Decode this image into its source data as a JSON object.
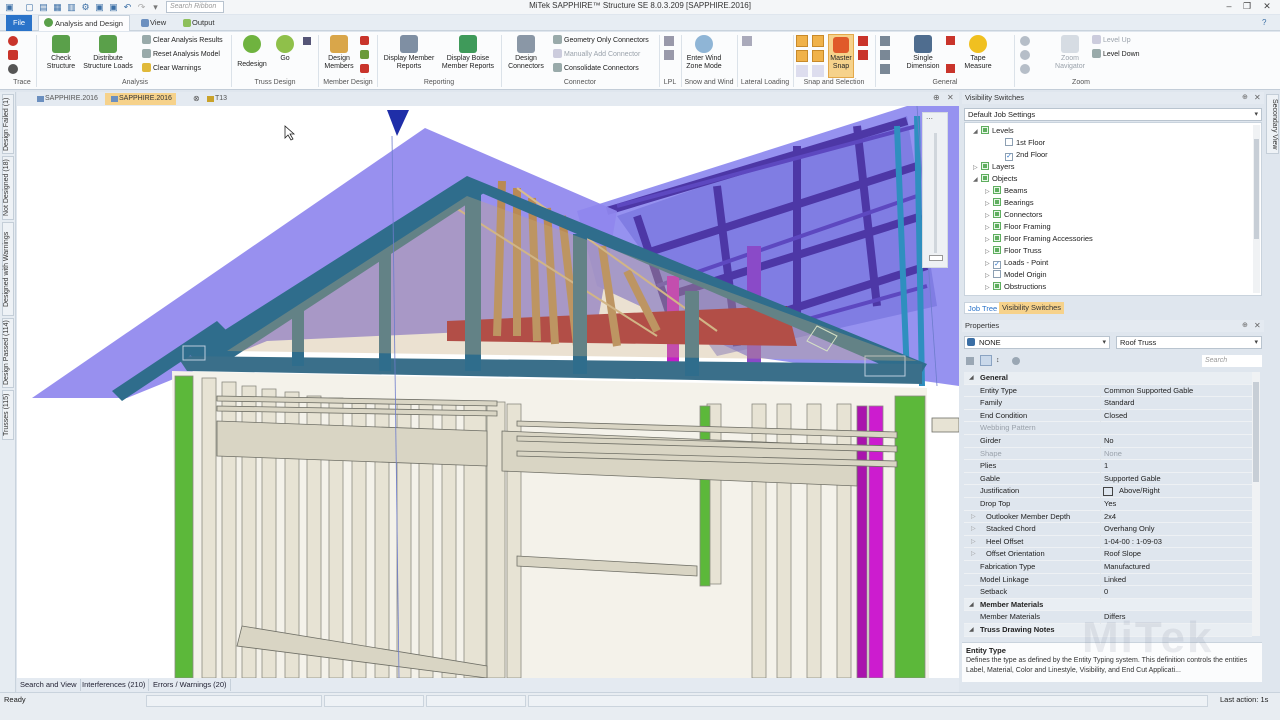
{
  "app": {
    "title": "MiTek SAPPHIRE™ Structure SE 8.0.3.209  [SAPPHIRE.2016]",
    "search_placeholder": "Search Ribbon",
    "watermark": "MiTek"
  },
  "tabs": [
    {
      "label": "File"
    },
    {
      "label": "Analysis and Design"
    },
    {
      "label": "View"
    },
    {
      "label": "Output"
    }
  ],
  "ribbon": {
    "trace": "Trace",
    "check_structure": "Check\nStructure",
    "distribute": "Distribute\nStructure Loads",
    "clear_results": "Clear Analysis Results",
    "reset_model": "Reset Analysis Model",
    "clear_warnings": "Clear Warnings",
    "redesign": "Redesign",
    "go": "Go",
    "design_members": "Design\nMembers",
    "display_member_reports": "Display Member\nReports",
    "display_boise": "Display Boise\nMember Reports",
    "design_connectors": "Design\nConnectors",
    "geometry_only": "Geometry Only Connectors",
    "manually_add": "Manually Add Connector",
    "consolidate": "Consolidate Connectors",
    "enter_wind": "Enter Wind\nZone Mode",
    "master_snap": "Master\nSnap",
    "single_dimension": "Single\nDimension",
    "tape_measure": "Tape\nMeasure",
    "zoom_navigator": "Zoom\nNavigator",
    "level_up": "Level Up",
    "level_down": "Level Down",
    "groups": {
      "analysis": "Analysis",
      "truss_design": "Truss Design",
      "member_design": "Member Design",
      "reporting": "Reporting",
      "connector": "Connector",
      "lpl": "LPL",
      "snow_wind": "Snow and Wind",
      "lateral": "Lateral Loading",
      "snap": "Snap and Selection",
      "general": "General",
      "zoom": "Zoom"
    }
  },
  "left_tabs": [
    "Design Failed (1)",
    "Not Designed (18)",
    "Designed with Warnings",
    "Design Passed (114)",
    "Trusses (115)"
  ],
  "doc_tabs": [
    {
      "label": "SAPPHIRE.2016",
      "active": false
    },
    {
      "label": "SAPPHIRE.2016",
      "active": true
    },
    {
      "label": "T13",
      "active": false
    }
  ],
  "visibility": {
    "header": "Visibility Switches",
    "job": "Default Job Settings",
    "items": [
      {
        "label": "Levels",
        "indent": 0,
        "expanded": true,
        "checked": "green"
      },
      {
        "label": "1st Floor",
        "indent": 2,
        "checked": "none"
      },
      {
        "label": "2nd Floor",
        "indent": 2,
        "checked": "check"
      },
      {
        "label": "Layers",
        "indent": 0,
        "expanded": false,
        "checked": "green"
      },
      {
        "label": "Objects",
        "indent": 0,
        "expanded": true,
        "checked": "green"
      },
      {
        "label": "Beams",
        "indent": 1,
        "checked": "green"
      },
      {
        "label": "Bearings",
        "indent": 1,
        "checked": "green"
      },
      {
        "label": "Connectors",
        "indent": 1,
        "checked": "green"
      },
      {
        "label": "Floor Framing",
        "indent": 1,
        "checked": "green"
      },
      {
        "label": "Floor Framing Accessories",
        "indent": 1,
        "checked": "green"
      },
      {
        "label": "Floor Truss",
        "indent": 1,
        "checked": "green"
      },
      {
        "label": "Loads - Point",
        "indent": 1,
        "checked": "check"
      },
      {
        "label": "Model Origin",
        "indent": 1,
        "checked": "none"
      },
      {
        "label": "Obstructions",
        "indent": 1,
        "checked": "green"
      }
    ],
    "tab_job_tree": "Job Tree",
    "tab_visibility": "Visibility Switches"
  },
  "properties": {
    "header": "Properties",
    "selector": "NONE",
    "type": "Roof Truss",
    "search_placeholder": "Search",
    "rows": [
      {
        "name": "General",
        "value": "",
        "kind": "cat"
      },
      {
        "name": "Entity Type",
        "value": "Common Supported Gable",
        "kind": "row"
      },
      {
        "name": "Family",
        "value": "Standard",
        "kind": "row"
      },
      {
        "name": "End Condition",
        "value": "Closed",
        "kind": "row"
      },
      {
        "name": "Webbing Pattern",
        "value": "",
        "kind": "dim"
      },
      {
        "name": "Girder",
        "value": "No",
        "kind": "row"
      },
      {
        "name": "Shape",
        "value": "None",
        "kind": "dim"
      },
      {
        "name": "Plies",
        "value": "1",
        "kind": "row"
      },
      {
        "name": "Gable",
        "value": "Supported Gable",
        "kind": "row"
      },
      {
        "name": "Justification",
        "value": "Above/Right",
        "kind": "row"
      },
      {
        "name": "Drop Top",
        "value": "Yes",
        "kind": "row"
      },
      {
        "name": "Outlooker Member Depth",
        "value": "2x4",
        "kind": "sub"
      },
      {
        "name": "Stacked Chord",
        "value": "Overhang Only",
        "kind": "sub"
      },
      {
        "name": "Heel Offset",
        "value": "1-04-00 : 1-09-03",
        "kind": "sub"
      },
      {
        "name": "Offset Orientation",
        "value": "Roof Slope",
        "kind": "sub"
      },
      {
        "name": "Fabrication Type",
        "value": "Manufactured",
        "kind": "row"
      },
      {
        "name": "Model Linkage",
        "value": "Linked",
        "kind": "row"
      },
      {
        "name": "Setback",
        "value": "0",
        "kind": "row"
      },
      {
        "name": "Member Materials",
        "value": "",
        "kind": "cat"
      },
      {
        "name": "Member Materials",
        "value": "Differs",
        "kind": "row"
      },
      {
        "name": "Truss Drawing Notes",
        "value": "",
        "kind": "cat"
      }
    ],
    "desc_title": "Entity Type",
    "desc_text": "Defines the type as defined by the Entity Typing system. This definition controls the entities Label, Material, Color and Linestyle, Visibility, and End Cut Applicati..."
  },
  "bottom_tabs": [
    "Search and View",
    "Interferences (210)",
    "Errors / Warnings (20)"
  ],
  "status": {
    "left": "Ready",
    "right": "Last action: 1s"
  },
  "right_vtab": "Secondary View",
  "colors": {
    "accent": "#2a73c9",
    "roof": "#8f87ee",
    "truss_chord": "#2f6d8c",
    "wall_stud": "#e7e3d4",
    "green_stud": "#5cb83a",
    "magenta": "#cc1ccf",
    "purple_truss": "#5b3fae",
    "red_beam": "#a81e2b"
  }
}
